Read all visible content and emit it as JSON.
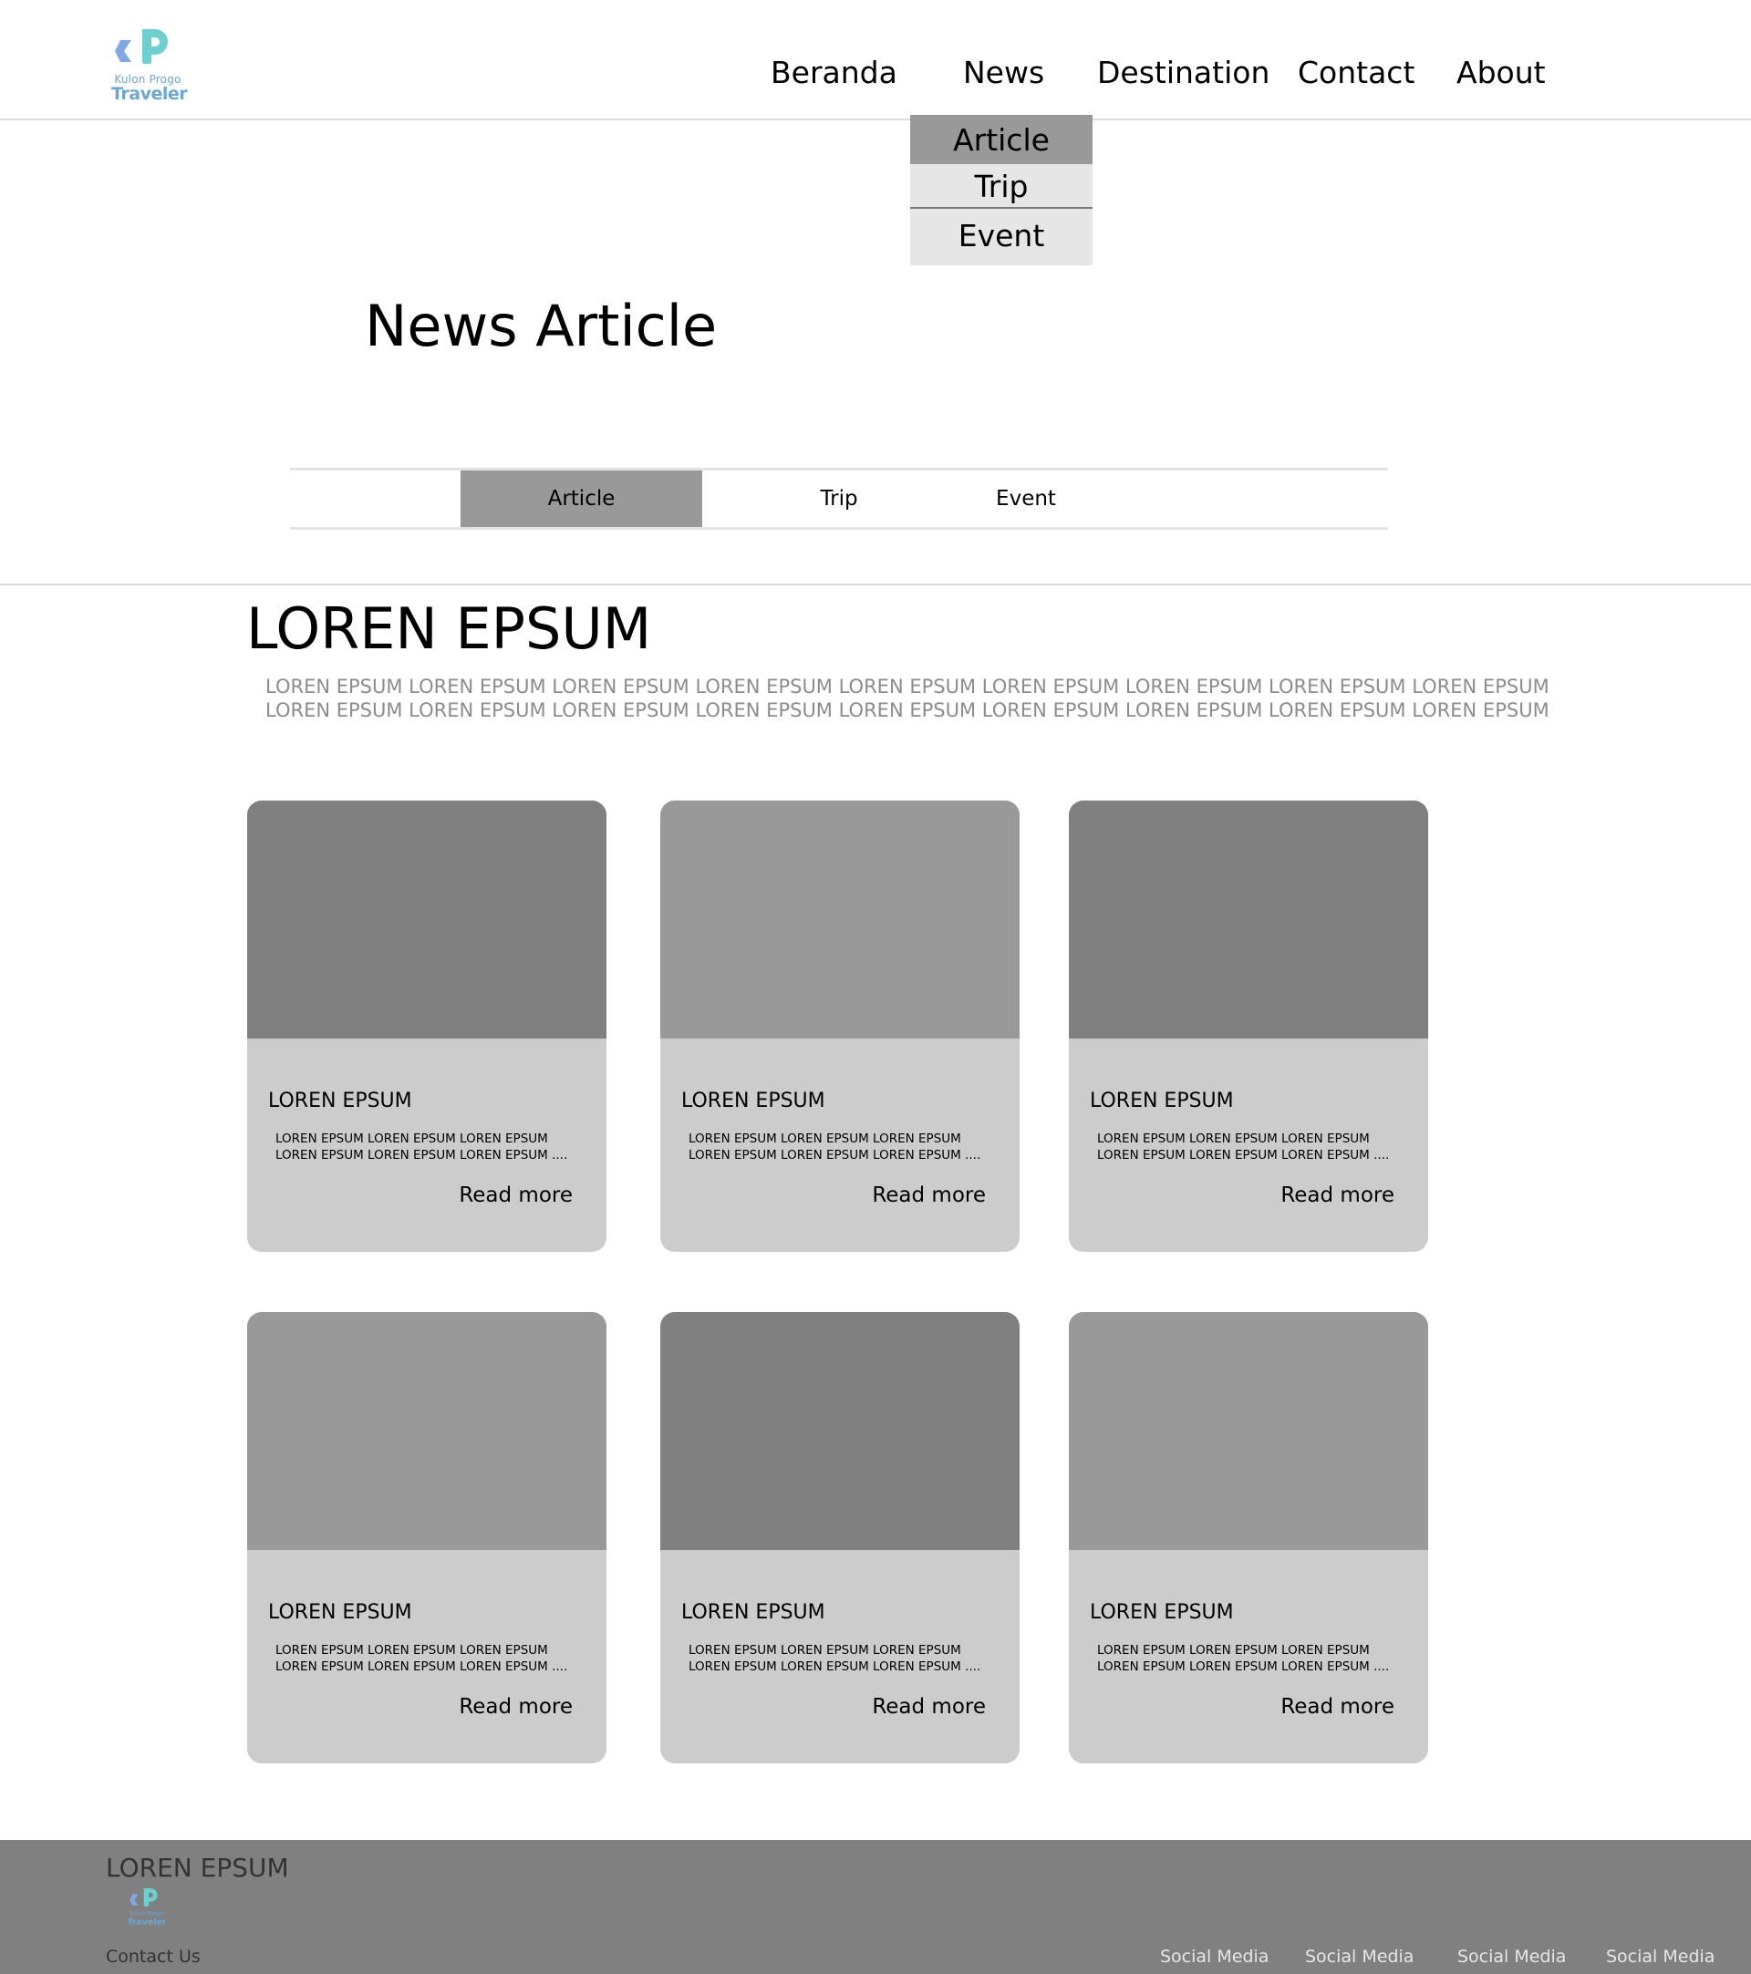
{
  "header": {
    "logo": {
      "line1": "Kulon Progo",
      "line2": "Traveler"
    },
    "nav": [
      "Beranda",
      "News",
      "Destination",
      "Contact",
      "About"
    ]
  },
  "dropdown": {
    "items": [
      "Article",
      "Trip",
      "Event"
    ],
    "active": "Article"
  },
  "page_title": "News Article",
  "tabs": {
    "items": [
      "Article",
      "Trip",
      "Event"
    ],
    "active": "Article"
  },
  "section": {
    "title": "LOREN EPSUM",
    "text_lines": [
      "LOREN EPSUM LOREN EPSUM LOREN EPSUM LOREN EPSUM LOREN EPSUM LOREN EPSUM LOREN EPSUM LOREN EPSUM LOREN EPSUM",
      "LOREN EPSUM LOREN EPSUM LOREN EPSUM LOREN EPSUM LOREN EPSUM LOREN EPSUM LOREN EPSUM LOREN EPSUM LOREN EPSUM"
    ]
  },
  "cards": [
    {
      "title": "LOREN EPSUM",
      "text_line1": "LOREN EPSUM LOREN EPSUM LOREN EPSUM",
      "text_line2": "LOREN EPSUM LOREN EPSUM LOREN EPSUM ....",
      "read_more": "Read more",
      "image_color": "#808080"
    },
    {
      "title": "LOREN EPSUM",
      "text_line1": "LOREN EPSUM LOREN EPSUM LOREN EPSUM",
      "text_line2": "LOREN EPSUM LOREN EPSUM LOREN EPSUM ....",
      "read_more": "Read more",
      "image_color": "#999999"
    },
    {
      "title": "LOREN EPSUM",
      "text_line1": "LOREN EPSUM LOREN EPSUM LOREN EPSUM",
      "text_line2": "LOREN EPSUM LOREN EPSUM LOREN EPSUM ....",
      "read_more": "Read more",
      "image_color": "#808080"
    },
    {
      "title": "LOREN EPSUM",
      "text_line1": "LOREN EPSUM LOREN EPSUM LOREN EPSUM",
      "text_line2": "LOREN EPSUM LOREN EPSUM LOREN EPSUM ....",
      "read_more": "Read more",
      "image_color": "#999999"
    },
    {
      "title": "LOREN EPSUM",
      "text_line1": "LOREN EPSUM LOREN EPSUM LOREN EPSUM",
      "text_line2": "LOREN EPSUM LOREN EPSUM LOREN EPSUM ....",
      "read_more": "Read more",
      "image_color": "#808080"
    },
    {
      "title": "LOREN EPSUM",
      "text_line1": "LOREN EPSUM LOREN EPSUM LOREN EPSUM",
      "text_line2": "LOREN EPSUM LOREN EPSUM LOREN EPSUM ....",
      "read_more": "Read more",
      "image_color": "#999999"
    }
  ],
  "footer": {
    "title": "LOREN EPSUM",
    "contact": "Contact Us",
    "social": [
      "Social Media",
      "Social Media",
      "Social Media",
      "Social Media"
    ]
  },
  "colors": {
    "brand_teal": "#6dd0d0",
    "brand_blue": "#6aa6d8",
    "active_gray": "#999999",
    "footer_bg": "#808080"
  }
}
